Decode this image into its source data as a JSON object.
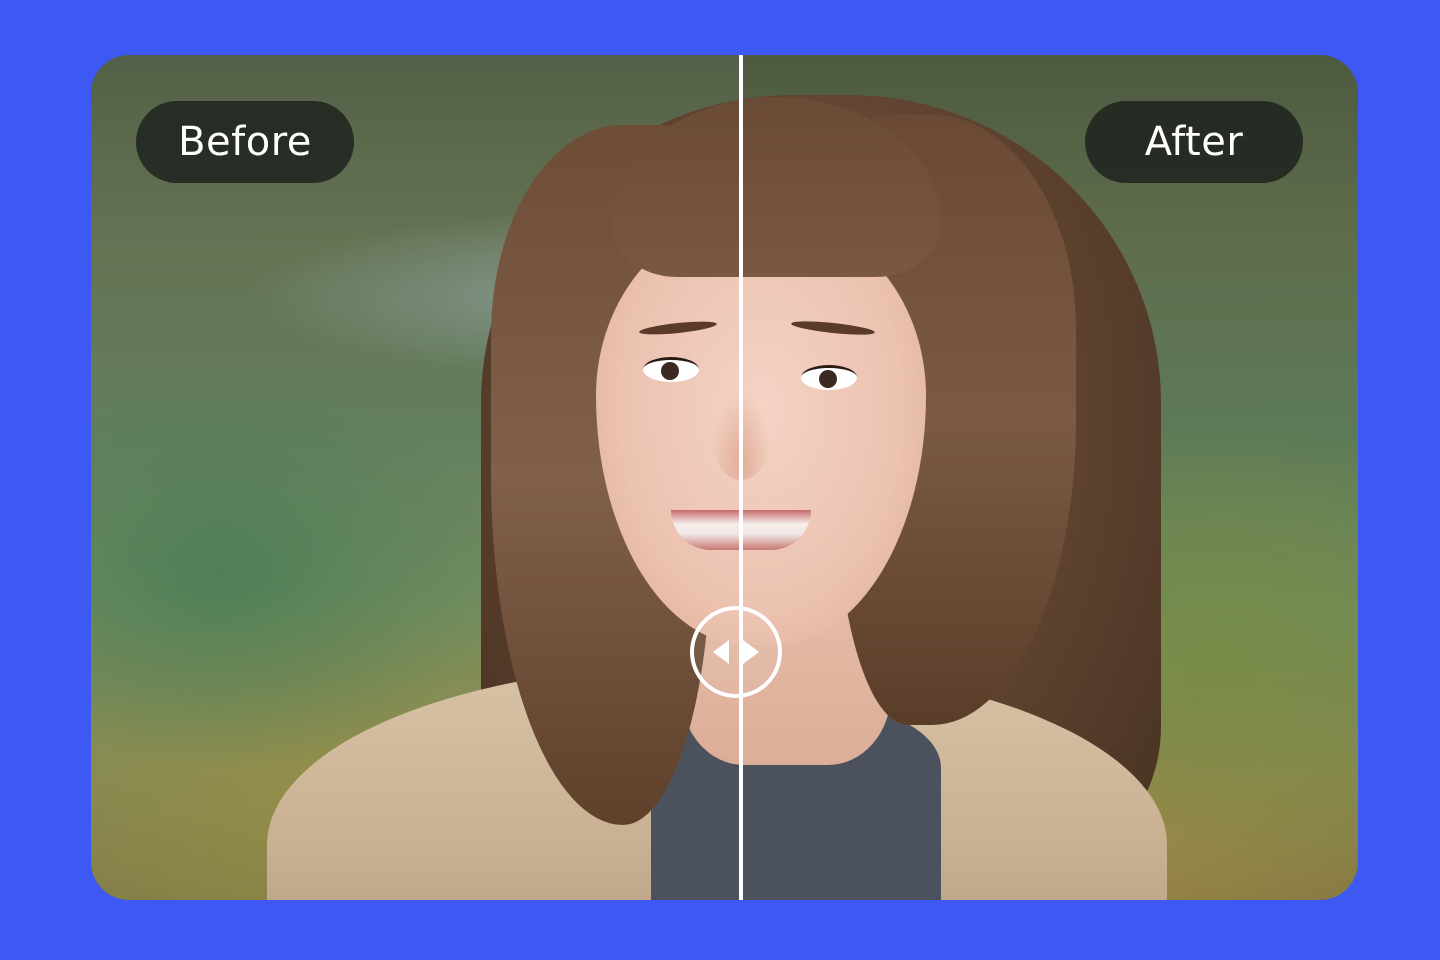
{
  "labels": {
    "before": "Before",
    "after": "After"
  },
  "slider": {
    "position": 0.512,
    "handle_icon": "left-right-arrows-icon"
  },
  "colors": {
    "page_background": "#3e58f4",
    "label_background": "#1c201c",
    "label_text": "#ffffff",
    "divider": "#ffffff"
  },
  "image": {
    "subject": "portrait-photo"
  }
}
